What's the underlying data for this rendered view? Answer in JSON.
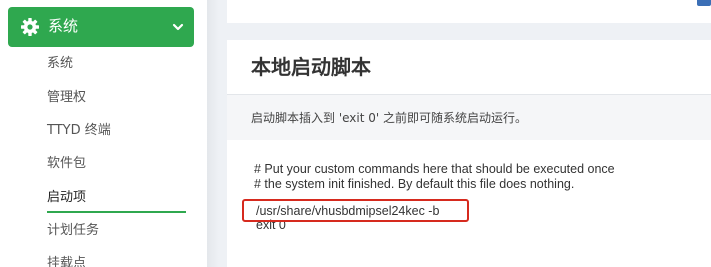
{
  "sidebar": {
    "group_title": "系统",
    "items": [
      {
        "label": "系统"
      },
      {
        "label": "管理权"
      },
      {
        "label": "TTYD 终端"
      },
      {
        "label": "软件包"
      },
      {
        "label": "启动项"
      },
      {
        "label": "计划任务"
      },
      {
        "label": "挂载点"
      }
    ],
    "active_index": 4
  },
  "main": {
    "title": "本地启动脚本",
    "description": "启动脚本插入到 'exit 0' 之前即可随系统启动运行。",
    "script_lines": [
      " # Put your custom commands here that should be executed once",
      " # the system init finished. By default this file does nothing.",
      "",
      "/usr/share/vhusbdmipsel24kec -b",
      "exit 0"
    ]
  },
  "colors": {
    "accent": "#2fa84f",
    "highlight_border": "#d62a1e"
  }
}
